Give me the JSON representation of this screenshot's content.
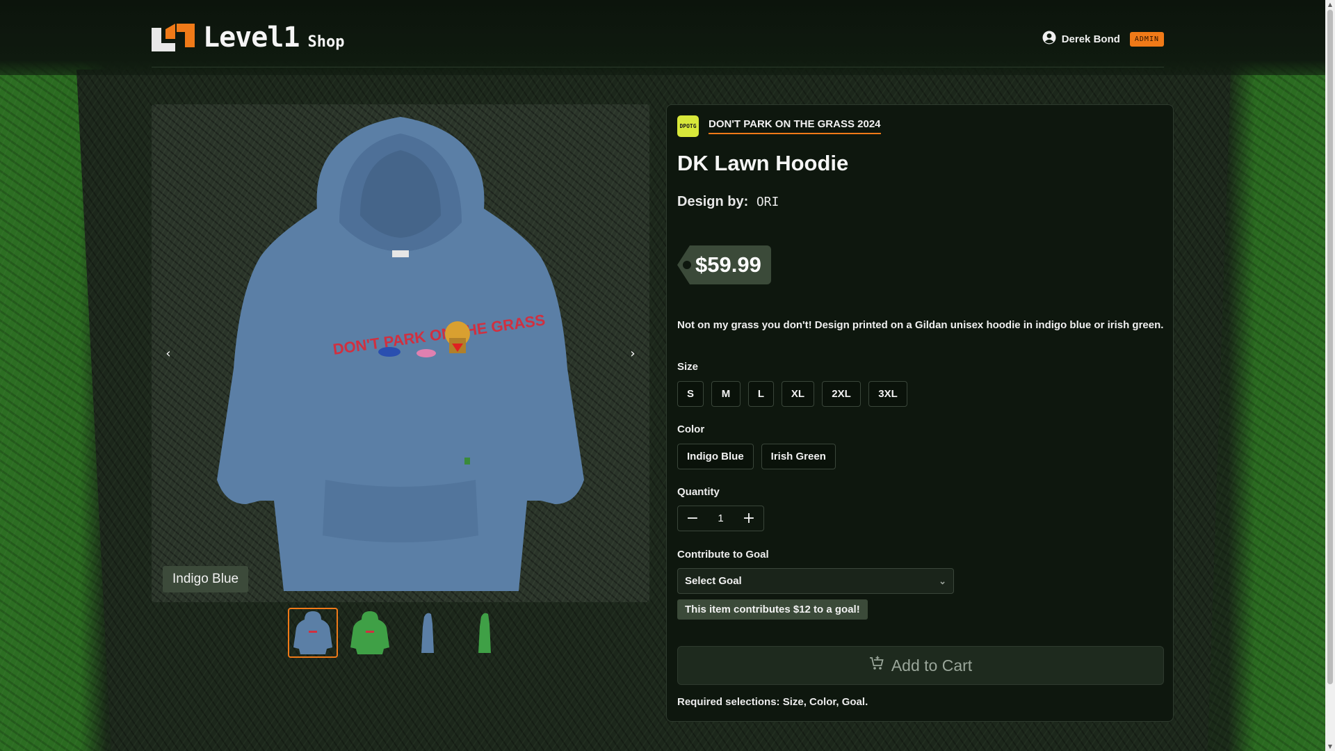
{
  "header": {
    "brand_word": "Level1",
    "brand_suffix": "Shop",
    "user_name": "Derek Bond",
    "user_badge": "ADMIN"
  },
  "gallery": {
    "image_caption": "Indigo Blue",
    "prev_icon": "chevron-left-icon",
    "next_icon": "chevron-right-icon",
    "thumbnails": [
      "indigo-blue-front",
      "irish-green-front",
      "indigo-blue-side",
      "irish-green-side"
    ],
    "active_thumbnail": 0
  },
  "product": {
    "collection_icon_text": "DPOTG",
    "collection": "DON'T PARK ON THE GRASS 2024",
    "title": "DK Lawn Hoodie",
    "designer_label": "Design by:",
    "designer": "ORI",
    "price": "$59.99",
    "description": "Not on my grass you don't! Design printed on a Gildan unisex hoodie in indigo blue or irish green."
  },
  "options": {
    "size_label": "Size",
    "sizes": [
      "S",
      "M",
      "L",
      "XL",
      "2XL",
      "3XL"
    ],
    "color_label": "Color",
    "colors": [
      "Indigo Blue",
      "Irish Green"
    ],
    "quantity_label": "Quantity",
    "quantity": "1",
    "goal_label": "Contribute to Goal",
    "goal_placeholder": "Select Goal",
    "contribution_note": "This item contributes $12 to a goal!"
  },
  "actions": {
    "add_to_cart": "Add to Cart",
    "required_note": "Required selections: Size, Color, Goal."
  },
  "colors": {
    "accent": "#f07a18",
    "hoodie_blue": "#5b7fa6",
    "hoodie_green": "#3fa046",
    "tag_bg": "#3b4a39"
  }
}
